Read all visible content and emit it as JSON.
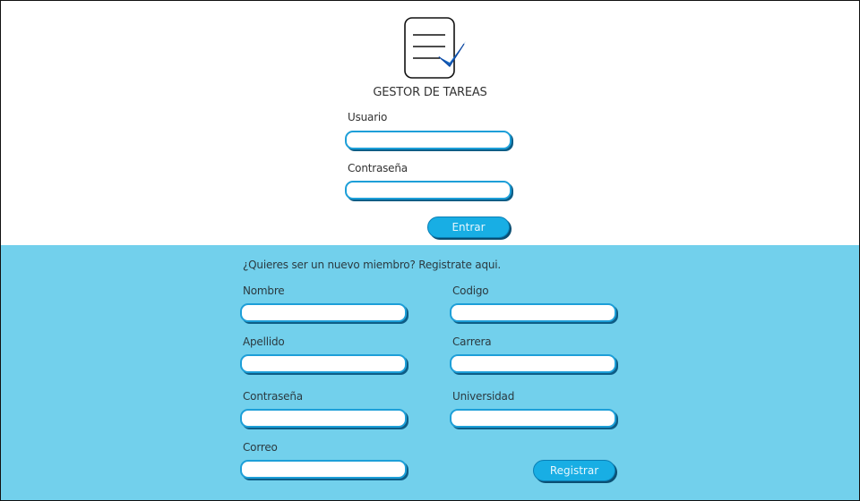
{
  "app": {
    "title": "GESTOR DE TAREAS",
    "logo_icon": "task-list-check-icon"
  },
  "login": {
    "username_label": "Usuario",
    "username_value": "",
    "password_label": "Contraseña",
    "password_value": "",
    "submit_label": "Entrar"
  },
  "register": {
    "intro": "¿Quieres ser un nuevo miembro? Registrate aqui.",
    "nombre_label": "Nombre",
    "apellido_label": "Apellido",
    "contrasena_label": "Contraseña",
    "correo_label": "Correo",
    "codigo_label": "Codigo",
    "carrera_label": "Carrera",
    "universidad_label": "Universidad",
    "submit_label": "Registrar"
  },
  "colors": {
    "accent": "#18aee4",
    "panel": "#72d0ec",
    "border": "#1d9fd8",
    "shadow": "#0d5d86"
  }
}
